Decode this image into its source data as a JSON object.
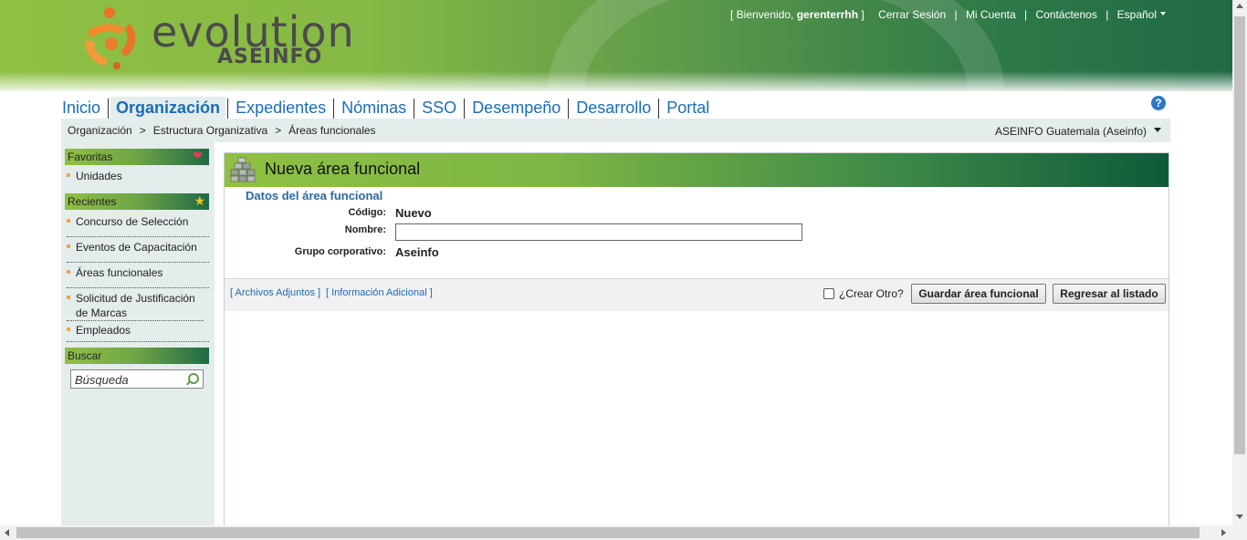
{
  "header": {
    "logo_word": "evolution",
    "logo_sub": "ASEINFO",
    "welcome_prefix": "[ Bienvenido, ",
    "username": "gerenterrhh",
    "welcome_suffix": " ]",
    "logout": "Cerrar Sesión",
    "account": "Mi Cuenta",
    "contact": "Contáctenos",
    "language": "Español",
    "link_separator": "|"
  },
  "nav": {
    "items": [
      "Inicio",
      "Organización",
      "Expedientes",
      "Nóminas",
      "SSO",
      "Desempeño",
      "Desarrollo",
      "Portal"
    ],
    "active": "Organización",
    "help_glyph": "?"
  },
  "breadcrumb": {
    "items": [
      "Organización",
      "Estructura Organizativa",
      "Áreas funcionales"
    ],
    "separator": ">",
    "company": "ASEINFO Guatemala (Aseinfo)"
  },
  "sidebar": {
    "favorites_title": "Favoritas",
    "favorites": [
      "Unidades"
    ],
    "recent_title": "Recientes",
    "recent": [
      "Concurso de Selección",
      "Eventos de Capacitación",
      "Áreas funcionales",
      "Solicitud de Justificación de Marcas",
      "Empleados"
    ],
    "search_title": "Buscar",
    "search_placeholder": "Búsqueda"
  },
  "form": {
    "title": "Nueva área funcional",
    "section": "Datos del área funcional",
    "code_label": "Código:",
    "code_value": "Nuevo",
    "name_label": "Nombre:",
    "name_value": "",
    "group_label": "Grupo corporativo:",
    "group_value": "Aseinfo"
  },
  "actions": {
    "attachments": "[ Archivos Adjuntos ]",
    "additional_info": "[ Información Adicional ]",
    "create_another": "¿Crear Otro?",
    "save": "Guardar área funcional",
    "back": "Regresar al listado"
  },
  "colors": {
    "brand_green": "#8fc043",
    "dark_green": "#1f6a44",
    "link_blue": "#1a6db8",
    "section_blue": "#2a6aa0"
  }
}
